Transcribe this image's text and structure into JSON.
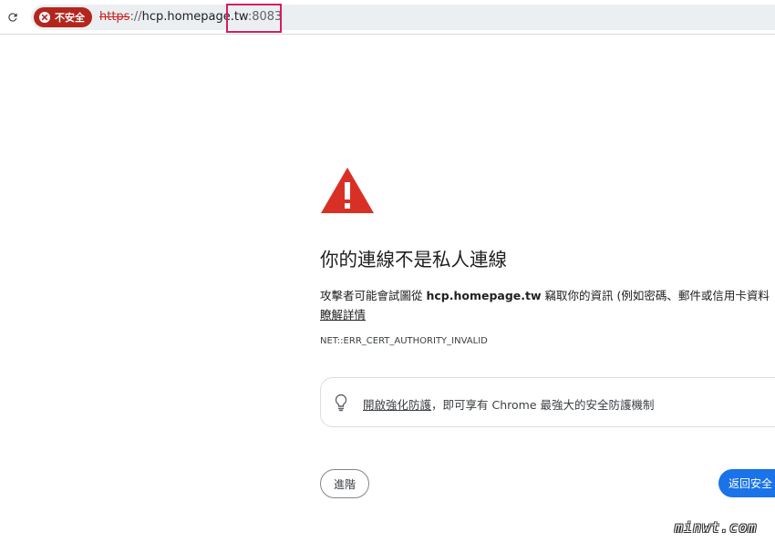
{
  "browser": {
    "security_chip": {
      "label": "不安全",
      "color": "#b3261e"
    },
    "url": {
      "scheme": "https",
      "separator": "://",
      "host": "hcp.homepage.tw",
      "port": ":8083"
    },
    "reload_icon": "reload-icon"
  },
  "interstitial": {
    "icon": "warning-triangle-icon",
    "icon_color": "#d93025",
    "heading": "你的連線不是私人連線",
    "explanation": {
      "prefix": "攻擊者可能會試圖從 ",
      "host": "hcp.homepage.tw",
      "suffix": " 竊取你的資訊 (例如密碼、郵件或信用卡資料"
    },
    "details_link": "瞭解詳情",
    "error_code": "NET::ERR_CERT_AUTHORITY_INVALID",
    "enhanced_protection": {
      "icon": "lightbulb-icon",
      "link": "開啟強化防護",
      "text": "，即可享有 Chrome 最強大的安全防護機制"
    },
    "advanced_button": "進階",
    "back_button": "返回安全"
  },
  "watermark": "minwt.com",
  "colors": {
    "primary": "#1a73e8",
    "highlight": "#d81b60"
  }
}
